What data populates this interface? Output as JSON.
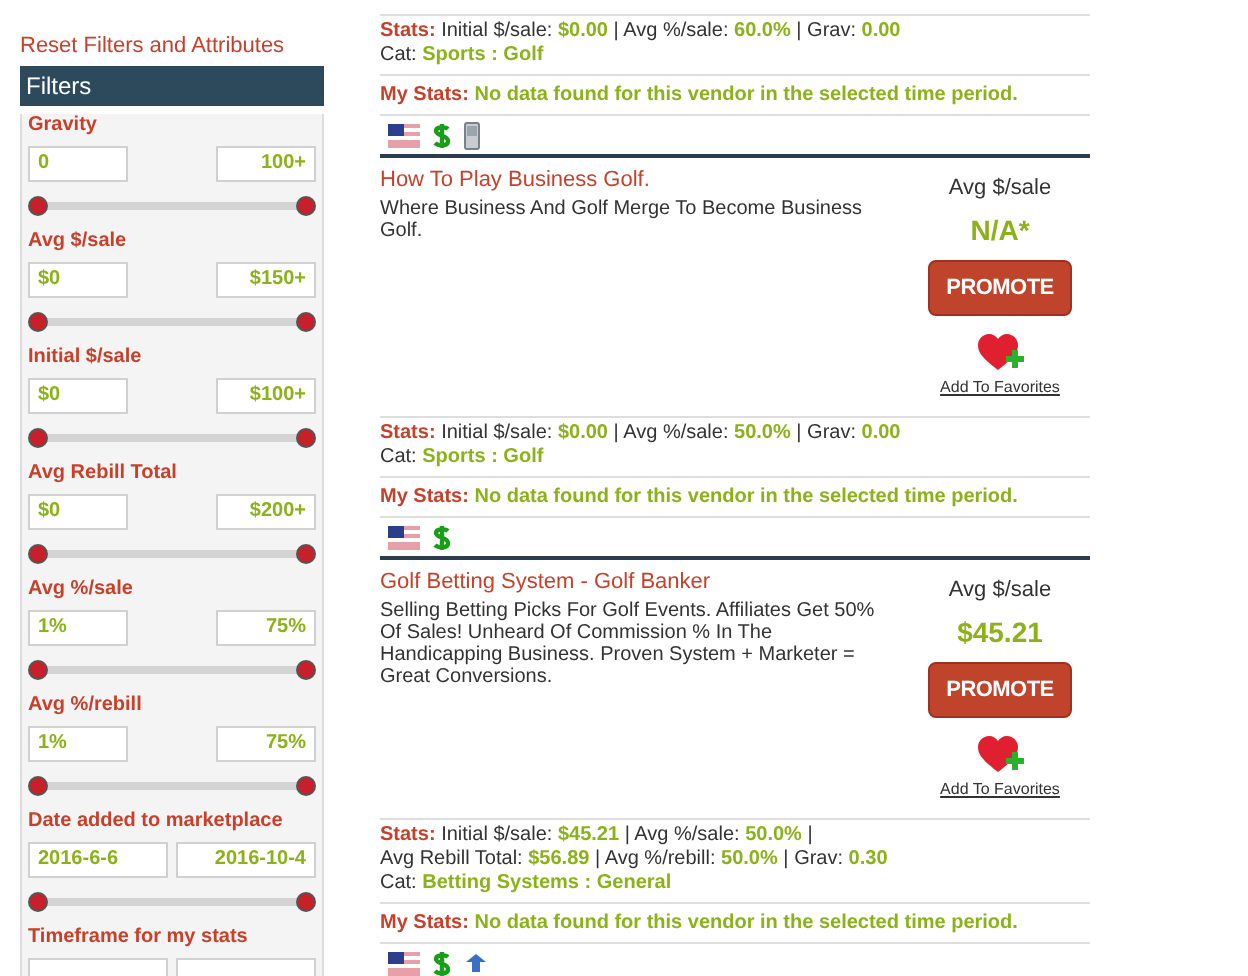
{
  "reset_link": "Reset Filters and Attributes",
  "filters": {
    "title": "Filters",
    "groups": [
      {
        "label": "Gravity",
        "min": "0",
        "max": "100+",
        "kind": "range",
        "level": 1
      },
      {
        "label": "Avg $/sale",
        "min": "$0",
        "max": "$150+",
        "kind": "range",
        "level": 1
      },
      {
        "label": "Initial $/sale",
        "min": "$0",
        "max": "$100+",
        "kind": "range",
        "level": 1
      },
      {
        "label": "Avg Rebill Total",
        "min": "$0",
        "max": "$200+",
        "kind": "range",
        "level": 1
      },
      {
        "label": "Avg %/sale",
        "min": "1%",
        "max": "75%",
        "kind": "range",
        "level": 1
      },
      {
        "label": "Avg %/rebill",
        "min": "1%",
        "max": "75%",
        "kind": "range",
        "level": 1
      },
      {
        "label": "Date added to marketplace",
        "min": "2016-6-6",
        "max": "2016-10-4",
        "kind": "date",
        "level": 1
      },
      {
        "label": "Timeframe for my stats",
        "kind": "date"
      }
    ]
  },
  "entries": [
    {
      "stats_label": "Stats:",
      "stats_separator": "|",
      "stats": [
        {
          "label": "Initial $/sale:",
          "value": "$0.00"
        },
        {
          "label": "Avg %/sale:",
          "value": "60.0%"
        },
        {
          "label": "Grav:",
          "value": "0.00"
        }
      ],
      "cat_label": "Cat:",
      "cat": "Sports : Golf",
      "my_stats_label": "My Stats:",
      "my_stats": "No data found for this vendor in the selected time period.",
      "icons": [
        {
          "kind": "flag"
        },
        {
          "kind": "dollar"
        },
        {
          "kind": "mobile"
        }
      ]
    },
    {
      "title": "How To Play Business Golf.",
      "description": "Where Business And Golf Merge To Become Business Golf.",
      "avg_label": "Avg $/sale",
      "avg_value": "N/A*",
      "promote": "PROMOTE",
      "favorites": "Add To Favorites",
      "stats_label": "Stats:",
      "stats_separator": "|",
      "stats": [
        {
          "label": "Initial $/sale:",
          "value": "$0.00"
        },
        {
          "label": "Avg %/sale:",
          "value": "50.0%"
        },
        {
          "label": "Grav:",
          "value": "0.00"
        }
      ],
      "cat_label": "Cat:",
      "cat": "Sports : Golf",
      "my_stats_label": "My Stats:",
      "my_stats": "No data found for this vendor in the selected time period.",
      "icons": [
        {
          "kind": "flag"
        },
        {
          "kind": "dollar"
        }
      ]
    },
    {
      "title": "Golf Betting System - Golf Banker",
      "description": "Selling Betting Picks For Golf Events. Affiliates Get 50% Of Sales! Unheard Of Commission % In The Handicapping Business. Proven System + Marketer = Great Conversions.",
      "avg_label": "Avg $/sale",
      "avg_value": "$45.21",
      "promote": "PROMOTE",
      "favorites": "Add To Favorites",
      "stats_label": "Stats:",
      "stats_separator": "|",
      "stats": [
        {
          "label": "Initial $/sale:",
          "value": "$45.21"
        },
        {
          "label": "Avg %/sale:",
          "value": "50.0%"
        },
        {
          "label": "Avg Rebill Total:",
          "value": "$56.89"
        },
        {
          "label": "Avg %/rebill:",
          "value": "50.0%"
        },
        {
          "label": "Grav:",
          "value": "0.30"
        }
      ],
      "cat_label": "Cat:",
      "cat": "Betting Systems : General",
      "my_stats_label": "My Stats:",
      "my_stats": "No data found for this vendor in the selected time period.",
      "icons": [
        {
          "kind": "flag"
        },
        {
          "kind": "dollar"
        },
        {
          "kind": "arrow"
        }
      ]
    }
  ]
}
